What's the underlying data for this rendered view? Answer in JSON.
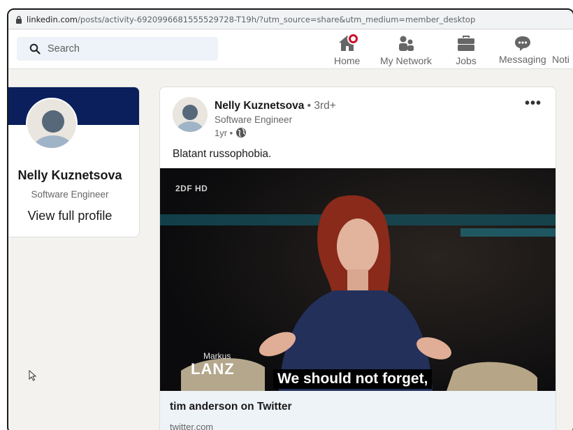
{
  "browser": {
    "url_host": "linkedin.com",
    "url_path": "/posts/activity-6920996681555529728-T19h/?utm_source=share&utm_medium=member_desktop"
  },
  "navbar": {
    "search_placeholder": "Search",
    "items": [
      {
        "label": "Home",
        "icon": "home-icon"
      },
      {
        "label": "My Network",
        "icon": "network-icon"
      },
      {
        "label": "Jobs",
        "icon": "briefcase-icon"
      },
      {
        "label": "Messaging",
        "icon": "messaging-icon"
      },
      {
        "label": "Noti",
        "icon": "notifications-icon"
      }
    ]
  },
  "profile": {
    "name": "Nelly Kuznetsova",
    "title": "Software Engineer",
    "link_label": "View full profile",
    "banner_color": "#0a1f5c"
  },
  "post": {
    "author_name": "Nelly Kuznetsova",
    "author_degree": "• 3rd+",
    "author_headline": "Software Engineer",
    "time": "1yr •",
    "text": "Blatant russophobia.",
    "media": {
      "channel_logo": "2DF HD",
      "show_small": "Markus",
      "show_big": "LANZ",
      "subtitle": "We should not forget,"
    },
    "link_title": "tim anderson on Twitter",
    "link_domain": "twitter.com"
  },
  "colors": {
    "brand": "#0a66c2",
    "notification": "#cb112d",
    "feed_bg": "#f4f2ee"
  }
}
